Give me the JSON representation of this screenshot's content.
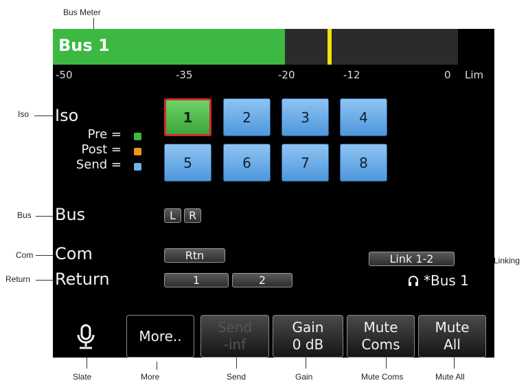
{
  "annotations": {
    "bus_meter": "Bus Meter",
    "iso": "Iso",
    "bus": "Bus",
    "com": "Com",
    "return": "Return",
    "linking": "Linking",
    "slate": "Slate",
    "more": "More",
    "send": "Send",
    "gain": "Gain",
    "mute_coms": "Mute Coms",
    "mute_all": "Mute All"
  },
  "meter": {
    "label": "Bus 1",
    "level_fraction": 0.525,
    "scale": [
      "-50",
      "-35",
      "-20",
      "-12",
      "0",
      "Lim"
    ],
    "colors": {
      "fill": "#3db843",
      "peak": "#f4e20b"
    }
  },
  "iso": {
    "label": "Iso",
    "legend": [
      {
        "text": "Pre =",
        "color": "#3db843"
      },
      {
        "text": "Post =",
        "color": "#f0951e"
      },
      {
        "text": "Send =",
        "color": "#6cb4ec"
      }
    ],
    "buttons": [
      "1",
      "2",
      "3",
      "4",
      "5",
      "6",
      "7",
      "8"
    ],
    "selected": "1"
  },
  "bus": {
    "label": "Bus",
    "left": "L",
    "right": "R"
  },
  "com": {
    "label": "Com",
    "rtn": "Rtn",
    "link": "Link 1-2"
  },
  "return": {
    "label": "Return",
    "btn1": "1",
    "btn2": "2",
    "headphone_target": "*Bus 1"
  },
  "softkeys": {
    "more": "More..",
    "send_line1": "Send",
    "send_line2": "-inf",
    "gain_line1": "Gain",
    "gain_line2": "0 dB",
    "mute_coms_line1": "Mute",
    "mute_coms_line2": "Coms",
    "mute_all_line1": "Mute",
    "mute_all_line2": "All"
  }
}
